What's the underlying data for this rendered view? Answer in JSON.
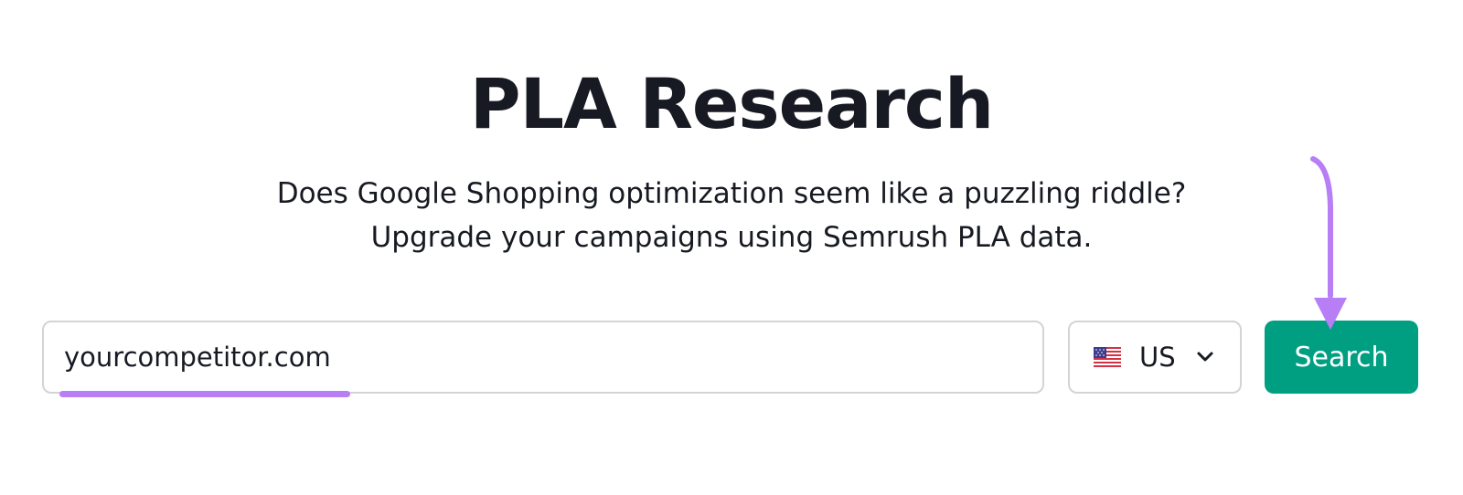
{
  "page": {
    "title": "PLA Research",
    "subtitle_line1": "Does Google Shopping optimization seem like a puzzling riddle?",
    "subtitle_line2": "Upgrade your campaigns using Semrush PLA data."
  },
  "search": {
    "value": "yourcompetitor.com",
    "placeholder": ""
  },
  "database": {
    "selected": "US",
    "flag_icon": "us-flag-icon",
    "dropdown_icon": "chevron-down-icon"
  },
  "search_button": {
    "label": "Search"
  },
  "annotations": {
    "arrow_icon": "arrow-down-icon",
    "highlight_color": "#b77ef6"
  },
  "colors": {
    "accent_button": "#009f81",
    "text": "#171a22",
    "border": "#d3d4d8",
    "annotation": "#b77ef6"
  }
}
